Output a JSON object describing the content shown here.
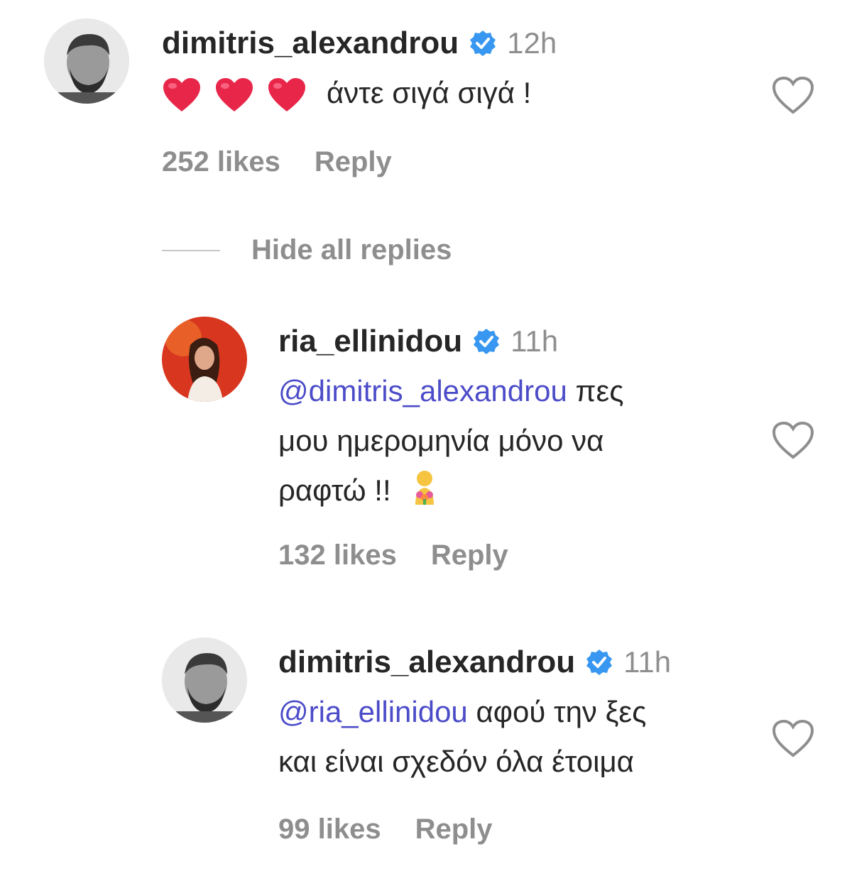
{
  "comments": [
    {
      "username": "dimitris_alexandrou",
      "time": "12h",
      "text": "άντε σιγά σιγά !",
      "likes": "252 likes",
      "reply": "Reply",
      "emojis": [
        "red-heart",
        "red-heart",
        "red-heart"
      ]
    },
    {
      "username": "ria_ellinidou",
      "time": "11h",
      "mention": "@dimitris_alexandrou",
      "line1_rest": " πες",
      "line2": "μου ημερομηνία μόνο να",
      "line3": "ραφτώ !!",
      "likes": "132 likes",
      "reply": "Reply",
      "emoji": "person-with-flowers"
    },
    {
      "username": "dimitris_alexandrou",
      "time": "11h",
      "mention": "@ria_ellinidou",
      "line1_rest": " αφού την ξες",
      "line2": "και είναι σχεδόν όλα έτοιμα",
      "likes": "99 likes",
      "reply": "Reply"
    }
  ],
  "hide_replies": "Hide all replies",
  "colors": {
    "mention": "#4c4cc9",
    "muted": "#8e8e8e",
    "verified": "#3897f0",
    "heart_emoji": "#e8264a"
  }
}
